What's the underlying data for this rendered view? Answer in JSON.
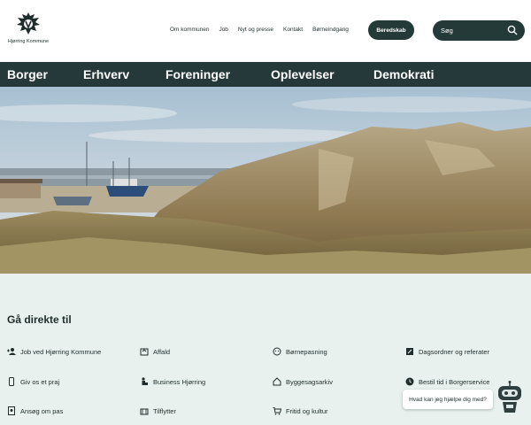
{
  "header": {
    "logo_text": "Hjørring Kommune",
    "links": [
      "Om kommunen",
      "Job",
      "Nyt og presse",
      "Kontakt",
      "Børneindgang"
    ],
    "beredskab_label": "Beredskab",
    "search_placeholder": "Søg"
  },
  "mainnav": [
    "Borger",
    "Erhverv",
    "Foreninger",
    "Oplevelser",
    "Demokrati"
  ],
  "hero": {
    "image": "dunes-and-beach-photo"
  },
  "quicklinks": {
    "title": "Gå direkte til",
    "items": [
      {
        "label": "Job ved Hjørring Kommune",
        "icon": "person-add-icon"
      },
      {
        "label": "Affald",
        "icon": "recycle-icon"
      },
      {
        "label": "Børnepasning",
        "icon": "child-face-icon"
      },
      {
        "label": "Dagsordner og referater",
        "icon": "edit-document-icon"
      },
      {
        "label": "Giv os et praj",
        "icon": "phone-icon"
      },
      {
        "label": "Business Hjørring",
        "icon": "person-briefcase-icon"
      },
      {
        "label": "Byggesagsarkiv",
        "icon": "house-icon"
      },
      {
        "label": "Bestil tid i Borgerservice",
        "icon": "clock-icon"
      },
      {
        "label": "Ansøg om pas",
        "icon": "passport-icon"
      },
      {
        "label": "Tilflytter",
        "icon": "moving-boxes-icon"
      },
      {
        "label": "Fritid og kultur",
        "icon": "cart-icon"
      }
    ]
  },
  "chat": {
    "prompt": "Hvad kan jeg hjælpe dig med?"
  },
  "colors": {
    "dark": "#26393a",
    "mint_bg": "#e8f1ee"
  }
}
